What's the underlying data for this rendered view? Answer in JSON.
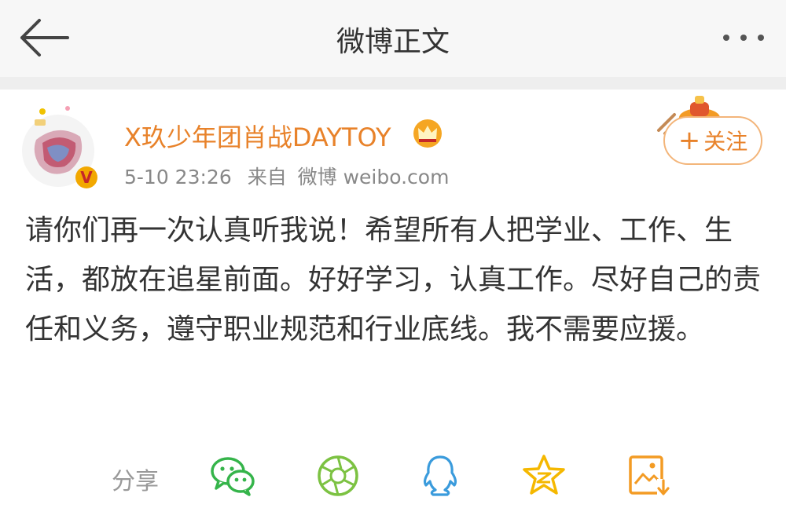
{
  "header": {
    "title": "微博正文",
    "back_icon": "back-arrow-icon",
    "more_icon": "more-dots-icon"
  },
  "post": {
    "author": "X玖少年团肖战DAYTOY",
    "time": "5-10 23:26",
    "source_prefix": "来自",
    "source": "微博 weibo.com",
    "follow_label": "关注",
    "text": "请你们再一次认真听我说！希望所有人把学业、工作、生活，都放在追星前面。好好学习，认真工作。尽好自己的责任和义务，遵守职业规范和行业底线。我不需要应援。"
  },
  "share": {
    "label": "分享",
    "targets": [
      "wechat-icon",
      "moments-icon",
      "qq-icon",
      "qzone-icon",
      "save-image-icon"
    ]
  },
  "colors": {
    "accent": "#e8822a",
    "share_green": "#35b44a",
    "qq_blue": "#3a9bdc",
    "qzone_yellow": "#f5b800",
    "save_orange": "#f39b24"
  }
}
